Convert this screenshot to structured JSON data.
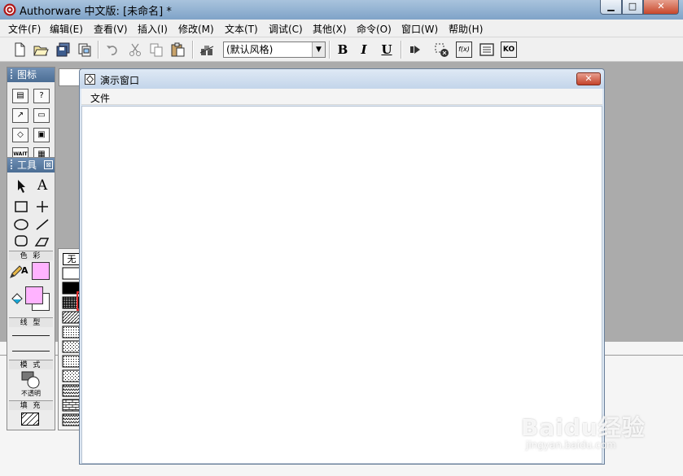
{
  "app": {
    "title": "Authorware 中文版: [未命名] *",
    "caption_buttons": {
      "minimize": "▁",
      "maximize": "□",
      "close": "✕"
    }
  },
  "menubar": [
    "文件(F)",
    "编辑(E)",
    "查看(V)",
    "插入(I)",
    "修改(M)",
    "文本(T)",
    "调试(C)",
    "其他(X)",
    "命令(O)",
    "窗口(W)",
    "帮助(H)"
  ],
  "toolbar": {
    "icons": [
      "new-file-icon",
      "open-file-icon",
      "save-all-icon",
      "import-icon",
      "undo-icon",
      "cut-icon",
      "copy-icon",
      "paste-icon",
      "find-icon"
    ],
    "style_select_value": "(默认风格)",
    "bold_label": "B",
    "italic_label": "I",
    "underline_label": "U",
    "right_icons": [
      "restart-icon",
      "control-panel-icon",
      "functions-icon",
      "variables-icon",
      "knowledge-objects-icon"
    ],
    "fx_label": "f(x)",
    "ko_label": "KO"
  },
  "icon_palette": {
    "title": "图标",
    "icons": [
      "display-icon",
      "motion-icon",
      "erase-icon",
      "wait-icon",
      "navigate-icon",
      "framework-icon"
    ],
    "wait_label": "WAIT",
    "question_label": "?"
  },
  "tools_palette": {
    "title": "工具",
    "close_label": "⊠",
    "text_tool_label": "A",
    "color_label": "色 彩",
    "line_label": "线 型",
    "mode_label": "模 式",
    "mode_value": "不透明",
    "fill_label": "填 充",
    "pencil_text_label": "A",
    "colors": {
      "pen": "#ffb3ff",
      "fill_fg": "#ffb3ff",
      "fill_bg": "#ffffff"
    }
  },
  "pattern_panel": {
    "none_label": "无",
    "rows": 12,
    "cols": 3,
    "selected_index": "row 4, column 2"
  },
  "presentation_window": {
    "title": "演示窗口",
    "close_label": "✕",
    "menu_file": "文件"
  },
  "watermark": {
    "main": "Baidu经验",
    "sub": "jingyan.baidu.com"
  }
}
